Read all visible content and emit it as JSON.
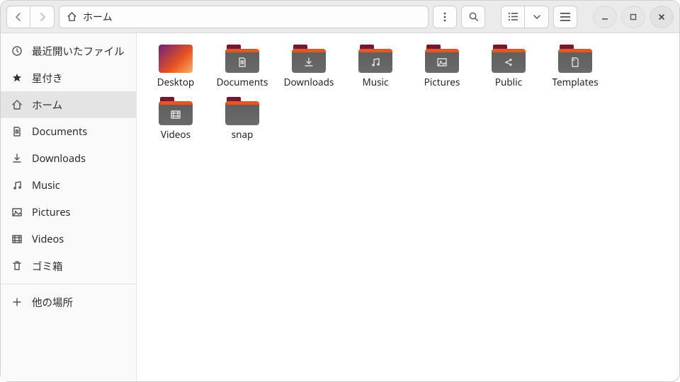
{
  "header": {
    "location_label": "ホーム"
  },
  "sidebar": {
    "items": [
      {
        "label": "最近開いたファイル",
        "icon": "clock"
      },
      {
        "label": "星付き",
        "icon": "star"
      },
      {
        "label": "ホーム",
        "icon": "home",
        "selected": true
      },
      {
        "label": "Documents",
        "icon": "doc"
      },
      {
        "label": "Downloads",
        "icon": "down"
      },
      {
        "label": "Music",
        "icon": "music"
      },
      {
        "label": "Pictures",
        "icon": "pic"
      },
      {
        "label": "Videos",
        "icon": "vid"
      },
      {
        "label": "ゴミ箱",
        "icon": "trash"
      }
    ],
    "other_label": "他の場所"
  },
  "files": [
    {
      "label": "Desktop",
      "kind": "desktop"
    },
    {
      "label": "Documents",
      "kind": "folder",
      "glyph": "doc"
    },
    {
      "label": "Downloads",
      "kind": "folder",
      "glyph": "down"
    },
    {
      "label": "Music",
      "kind": "folder",
      "glyph": "music"
    },
    {
      "label": "Pictures",
      "kind": "folder",
      "glyph": "pic"
    },
    {
      "label": "Public",
      "kind": "folder",
      "glyph": "share"
    },
    {
      "label": "Templates",
      "kind": "folder",
      "glyph": "tmpl"
    },
    {
      "label": "Videos",
      "kind": "folder",
      "glyph": "vid"
    },
    {
      "label": "snap",
      "kind": "folder-plain"
    }
  ]
}
